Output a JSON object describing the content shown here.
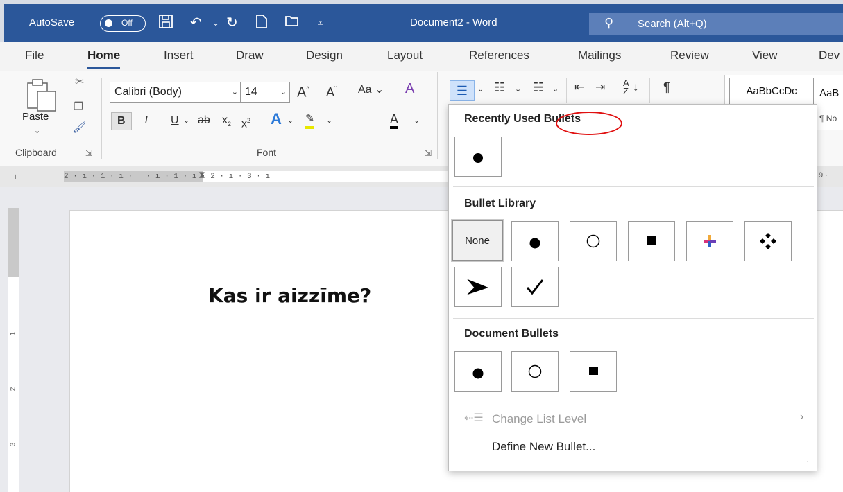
{
  "titlebar": {
    "autosave_label": "AutoSave",
    "autosave_state": "Off",
    "document_title": "Document2 - Word",
    "search_placeholder": "Search (Alt+Q)"
  },
  "tabs": [
    "File",
    "Home",
    "Insert",
    "Draw",
    "Design",
    "Layout",
    "References",
    "Mailings",
    "Review",
    "View",
    "Dev"
  ],
  "ribbon": {
    "paste_label": "Paste",
    "clipboard_label": "Clipboard",
    "font_label": "Font",
    "font_name": "Calibri (Body)",
    "font_size": "14",
    "case_label": "Aa",
    "style_preview_1": "AaBbCcDc",
    "style_preview_2": "AaB",
    "style_preview_2_sub": "¶ No"
  },
  "ruler": {
    "h_numbers": "2 · ı · 1 · ı ·   · ı · 1 · ı · 2 · ı · 3 · ı",
    "h_right": "9 ·",
    "v_numbers": [
      "1",
      "2",
      "3"
    ]
  },
  "document": {
    "heading": "Kas ir aizzīme?"
  },
  "bullets_menu": {
    "recently_used_title": "Recently Used Bullets",
    "library_title": "Bullet Library",
    "none_label": "None",
    "document_bullets_title": "Document Bullets",
    "change_list_level": "Change List Level",
    "define_new_bullet": "Define New Bullet..."
  },
  "colors": {
    "titlebar": "#2b579a",
    "annotation_circle": "#e01010",
    "underline": "#e8e800",
    "font_color": "#000000"
  }
}
